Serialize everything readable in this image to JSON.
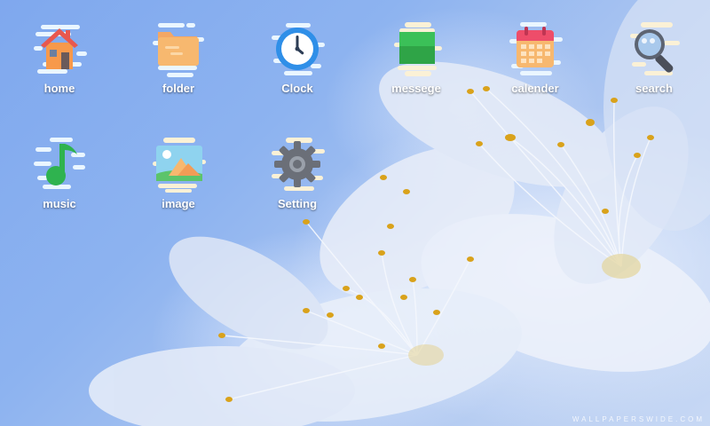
{
  "desktop": {
    "icons": [
      {
        "label": "home",
        "icon": "home-icon"
      },
      {
        "label": "folder",
        "icon": "folder-icon"
      },
      {
        "label": "Clock",
        "icon": "clock-icon"
      },
      {
        "label": "messege",
        "icon": "message-icon"
      },
      {
        "label": "calender",
        "icon": "calendar-icon"
      },
      {
        "label": "search",
        "icon": "search-icon"
      },
      {
        "label": "music",
        "icon": "music-icon"
      },
      {
        "label": "image",
        "icon": "image-icon"
      },
      {
        "label": "Setting",
        "icon": "gear-icon"
      }
    ]
  },
  "wallpaper": {
    "watermark": "WALLPAPERSWIDE.COM"
  },
  "colors": {
    "sky": "#8db3f0",
    "petal": "#eef2fb",
    "pollen": "#d9a21b",
    "label": "#ffffff"
  }
}
